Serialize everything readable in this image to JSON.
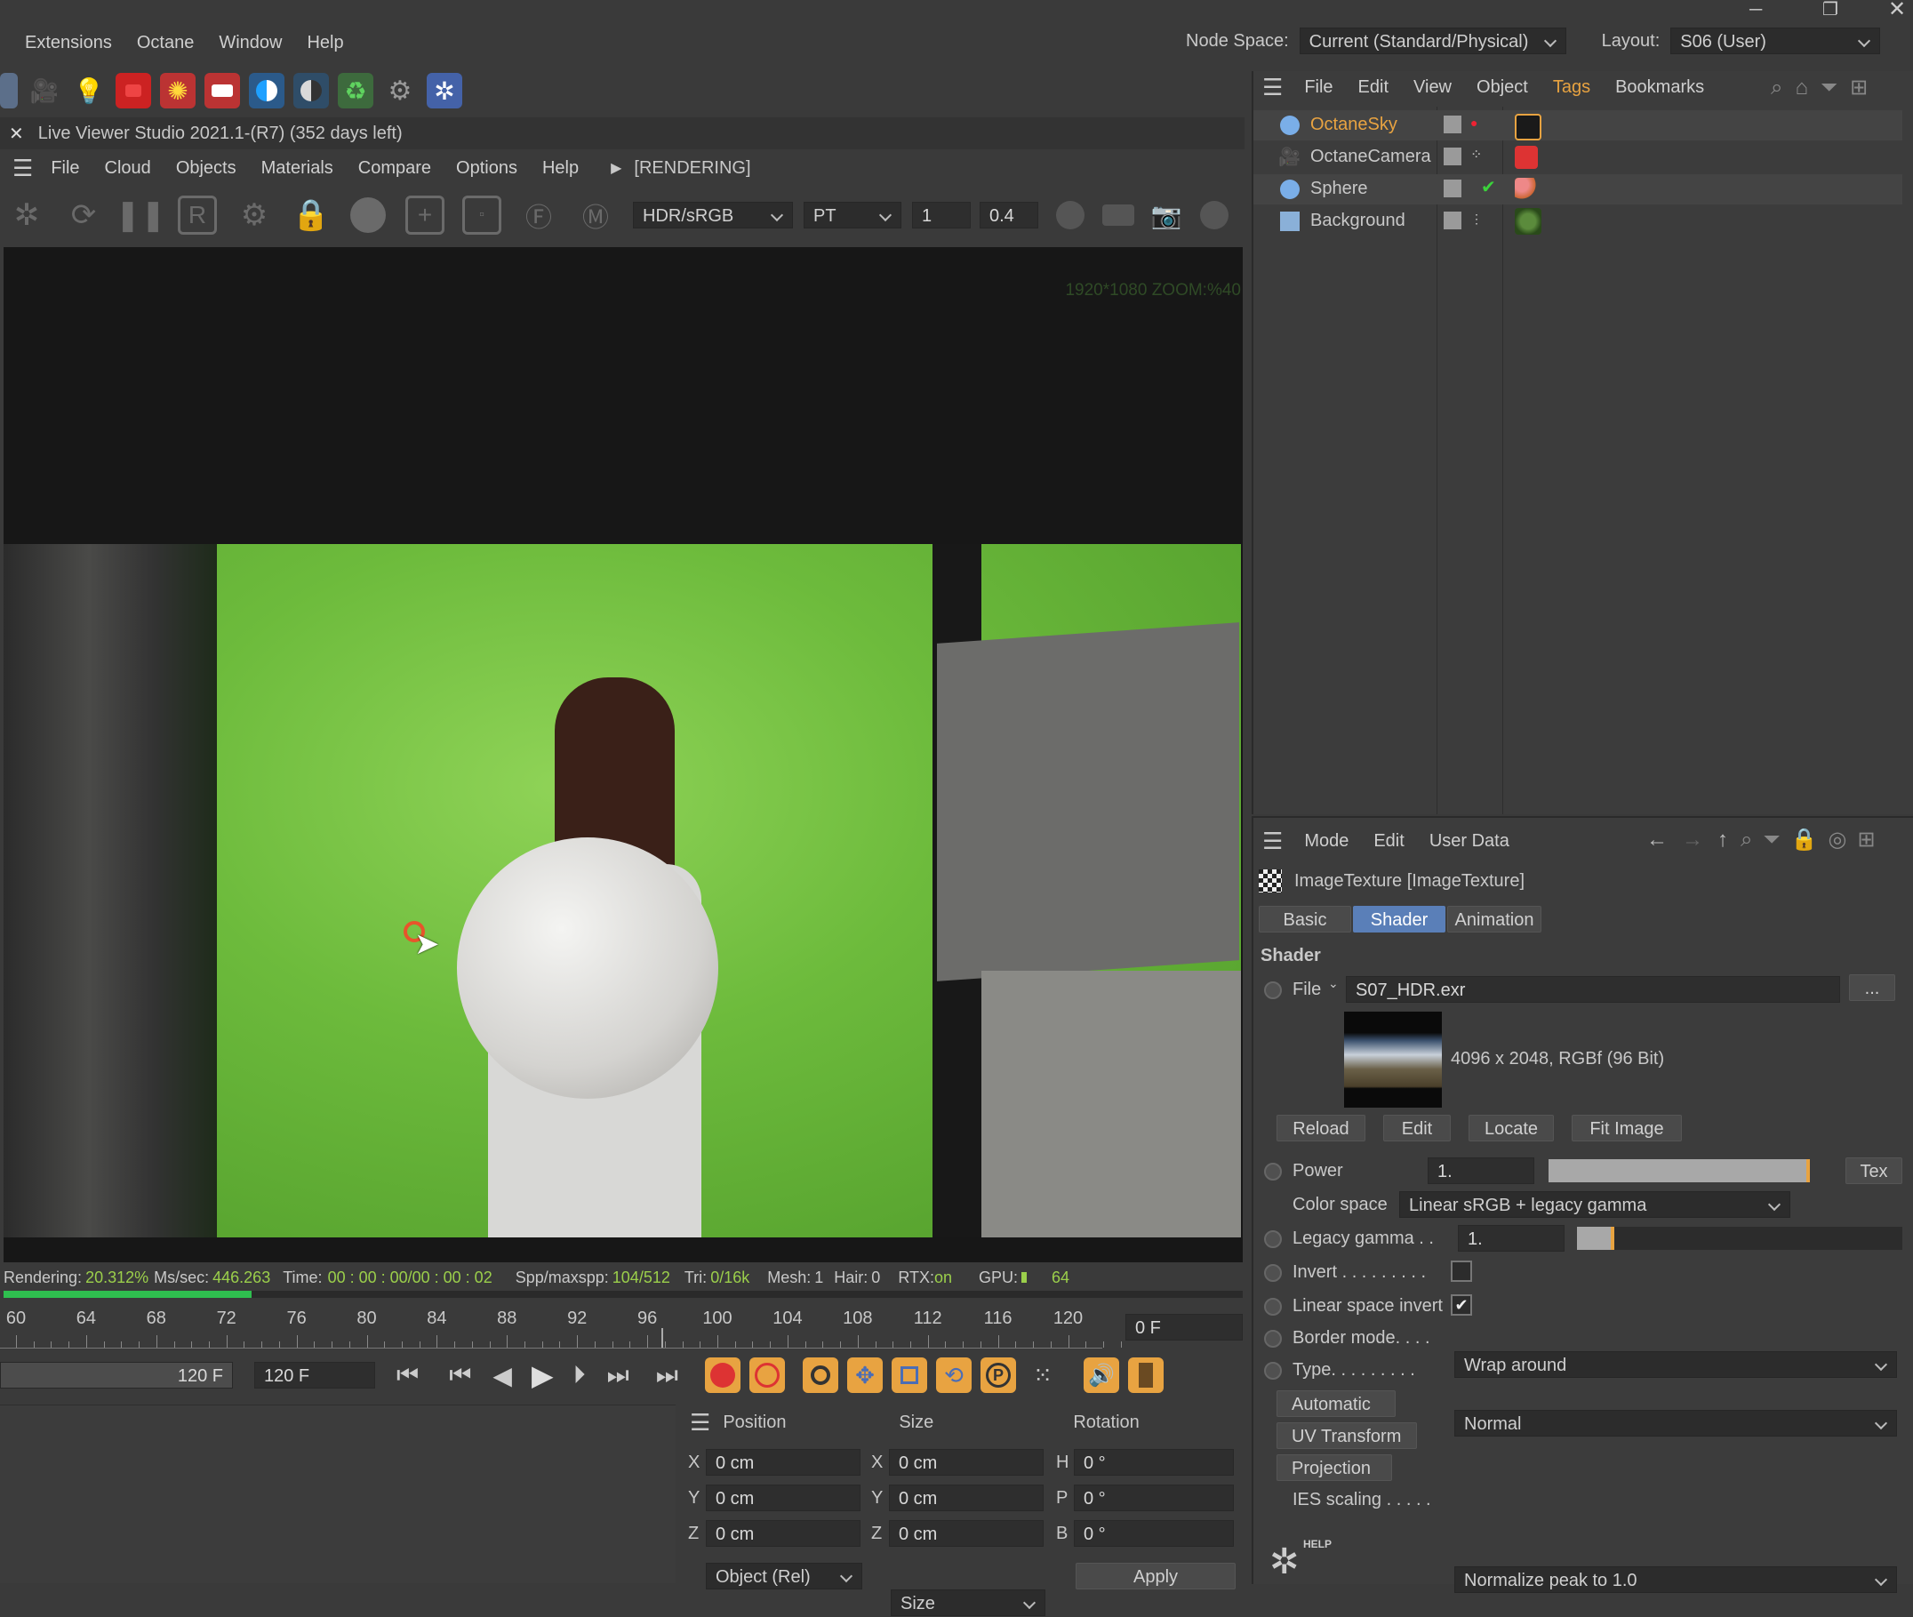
{
  "menubar": {
    "items": [
      "Extensions",
      "Octane",
      "Window",
      "Help"
    ],
    "node_space_label": "Node Space:",
    "node_space_value": "Current (Standard/Physical)",
    "layout_label": "Layout:",
    "layout_value": "S06 (User)"
  },
  "live_viewer": {
    "title": "Live Viewer Studio 2021.1-(R7) (352 days left)",
    "menu": [
      "File",
      "Cloud",
      "Objects",
      "Materials",
      "Compare",
      "Options",
      "Help"
    ],
    "status_tag": "[RENDERING]",
    "toolbar": {
      "tonemap": "HDR/sRGB",
      "kernel": "PT",
      "value1": "1",
      "value2": "0.4"
    },
    "resolution_overlay": "1920*1080 ZOOM:%40",
    "render_progress": 0.2,
    "statusbar": {
      "rendering_label": "Rendering:",
      "rendering_value": "20.312%",
      "ms_label": "Ms/sec:",
      "ms_value": "446.263",
      "time_label": "Time:",
      "time_value": "00 : 00 : 00/00 : 00 : 02",
      "spp_label": "Spp/maxspp:",
      "spp_value": "104/512",
      "tri_label": "Tri:",
      "tri_value": "0/16k",
      "mesh_label": "Mesh:",
      "mesh_value": "1",
      "hair_label": "Hair:",
      "hair_value": "0",
      "rtx_label": "RTX:",
      "rtx_value": "on",
      "gpu_label": "GPU:",
      "gpu_value": "64"
    }
  },
  "timeline": {
    "ticks": [
      "60",
      "64",
      "68",
      "72",
      "76",
      "80",
      "84",
      "88",
      "92",
      "96",
      "100",
      "104",
      "108",
      "112",
      "116",
      "120"
    ],
    "current_frame": "0 F",
    "end_frame_a": "120 F",
    "end_frame_b": "120 F"
  },
  "coords": {
    "headers": {
      "position": "Position",
      "size": "Size",
      "rotation": "Rotation"
    },
    "rows": [
      {
        "pos_axis": "X",
        "pos": "0 cm",
        "size_axis": "X",
        "size": "0 cm",
        "rot_axis": "H",
        "rot": "0 °"
      },
      {
        "pos_axis": "Y",
        "pos": "0 cm",
        "size_axis": "Y",
        "size": "0 cm",
        "rot_axis": "P",
        "rot": "0 °"
      },
      {
        "pos_axis": "Z",
        "pos": "0 cm",
        "size_axis": "Z",
        "size": "0 cm",
        "rot_axis": "B",
        "rot": "0 °"
      }
    ],
    "mode": "Object (Rel)",
    "size_mode": "Size",
    "apply": "Apply"
  },
  "object_manager": {
    "menu": [
      "File",
      "Edit",
      "View",
      "Object",
      "Tags",
      "Bookmarks"
    ],
    "objects": [
      {
        "name": "OctaneSky",
        "active": true
      },
      {
        "name": "OctaneCamera",
        "active": false
      },
      {
        "name": "Sphere",
        "active": false
      },
      {
        "name": "Background",
        "active": false
      }
    ]
  },
  "attributes": {
    "menu": [
      "Mode",
      "Edit",
      "User Data"
    ],
    "object_title": "ImageTexture [ImageTexture]",
    "tabs": [
      "Basic",
      "Shader",
      "Animation"
    ],
    "active_tab": "Shader",
    "section": "Shader",
    "file_label": "File",
    "file_value": "S07_HDR.exr",
    "browse": "...",
    "image_info": "4096 x 2048, RGBf (96 Bit)",
    "image_buttons": [
      "Reload",
      "Edit",
      "Locate",
      "Fit Image"
    ],
    "power_label": "Power",
    "power_value": "1.",
    "power_level": 1.0,
    "tex_button": "Tex",
    "color_space_label": "Color space",
    "color_space_value": "Linear sRGB + legacy gamma",
    "legacy_gamma_label": "Legacy gamma . .",
    "legacy_gamma_value": "1.",
    "invert_label": "Invert . . . . . . . . .",
    "invert_checked": false,
    "linear_invert_label": "Linear space invert",
    "linear_invert_checked": true,
    "border_label": "Border mode. . . .",
    "border_value": "Wrap around",
    "type_label": "Type. . . . . . . . .",
    "type_value": "Normal",
    "sub_buttons": [
      "Automatic",
      "UV Transform",
      "Projection"
    ],
    "ies_label": "IES scaling . . . . .",
    "ies_value": "Normalize peak to 1.0",
    "help_label": "HELP"
  },
  "colors": {
    "accent_orange": "#e8a341",
    "tab_active": "#5a7fb8",
    "green_screen": "#6dbb3c",
    "progress_green": "#2fbf4f"
  }
}
